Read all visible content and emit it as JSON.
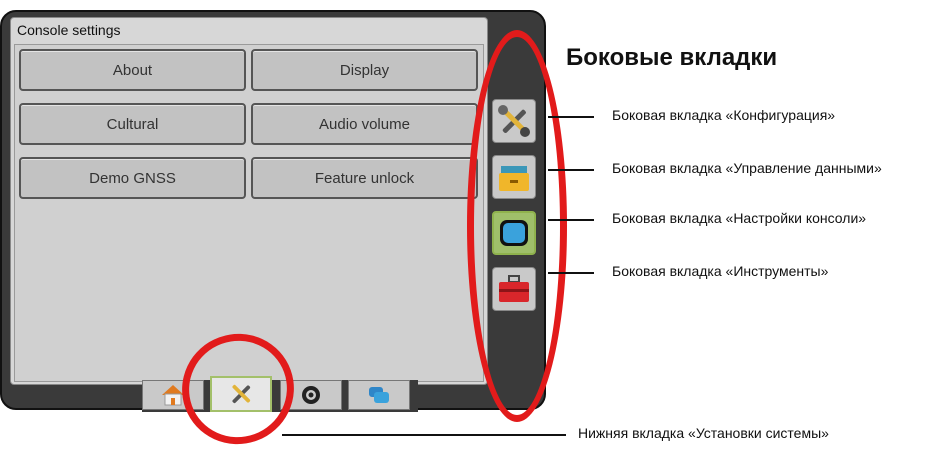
{
  "screen": {
    "title": "Console settings",
    "buttons": [
      {
        "label": "About"
      },
      {
        "label": "Display"
      },
      {
        "label": "Cultural"
      },
      {
        "label": "Audio volume"
      },
      {
        "label": "Demo GNSS"
      },
      {
        "label": "Feature unlock"
      }
    ]
  },
  "side_tabs": [
    {
      "icon": "wrench-screwdriver-icon"
    },
    {
      "icon": "file-drawer-icon"
    },
    {
      "icon": "monitor-icon",
      "active": true
    },
    {
      "icon": "toolbox-icon"
    }
  ],
  "bottom_tabs": [
    {
      "icon": "home-icon"
    },
    {
      "icon": "wrench-screwdriver-icon",
      "active": true
    },
    {
      "icon": "camera-lens-icon"
    },
    {
      "icon": "layers-icon"
    }
  ],
  "annotations": {
    "heading": "Боковые вкладки",
    "labels": [
      "Боковая вкладка «Конфигурация»",
      "Боковая вкладка «Управление данными»",
      "Боковая вкладка «Настройки консоли»",
      "Боковая вкладка «Инструменты»",
      "Нижняя вкладка «Установки системы»"
    ]
  },
  "colors": {
    "highlight": "#e21b1b",
    "active_tab": "#9fbf6a",
    "frame": "#3a3a3a"
  }
}
